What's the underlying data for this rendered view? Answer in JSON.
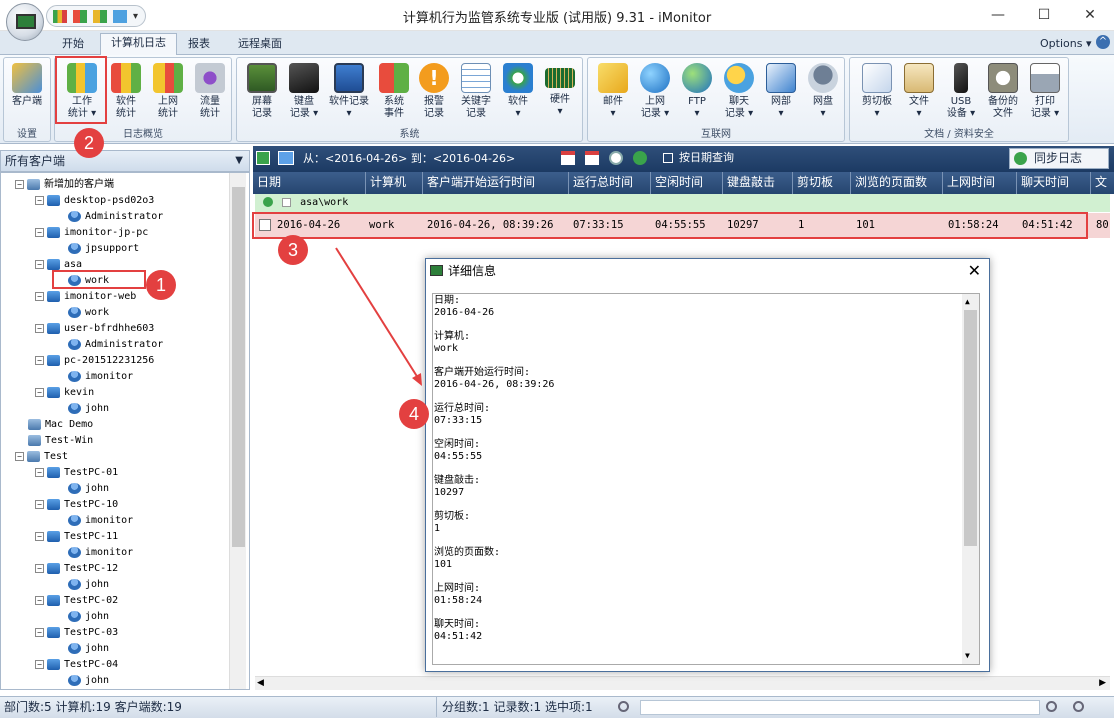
{
  "window": {
    "title": "计算机行为监管系统专业版 (试用版) 9.31 - iMonitor",
    "minimize": "—",
    "maximize": "☐",
    "close": "✕"
  },
  "ribbon": {
    "tabs": [
      "开始",
      "计算机日志",
      "报表",
      "远程桌面"
    ],
    "options": "Options ▾",
    "groups": [
      {
        "label": "设置",
        "buttons": [
          "客户端"
        ]
      },
      {
        "label": "日志概览",
        "buttons": [
          "工作\n统计 ▾",
          "软件\n统计",
          "上网\n统计",
          "流量\n统计"
        ]
      },
      {
        "label": "系统",
        "buttons": [
          "屏幕\n记录",
          "键盘\n记录 ▾",
          "软件记录\n▾",
          "系统\n事件",
          "报警\n记录",
          "关键字\n记录",
          "软件\n▾",
          "硬件\n▾"
        ]
      },
      {
        "label": "互联网",
        "buttons": [
          "邮件\n▾",
          "上网\n记录 ▾",
          "FTP\n▾",
          "聊天\n记录 ▾",
          "网部\n▾",
          "网盘\n▾"
        ]
      },
      {
        "label": "文档 / 资料安全",
        "buttons": [
          "剪切板\n▾",
          "文件\n▾",
          "USB\n设备 ▾",
          "备份的\n文件",
          "打印\n记录 ▾"
        ]
      }
    ]
  },
  "left_panel": {
    "header": "所有客户端",
    "tree": [
      {
        "label": "新增加的客户端",
        "level": 0,
        "icon": "group-icon",
        "expander": "−"
      },
      {
        "label": "desktop-psd02o3",
        "level": 1,
        "icon": "computer-icon",
        "expander": "−"
      },
      {
        "label": "Administrator",
        "level": 2,
        "icon": "user-icon",
        "expander": ""
      },
      {
        "label": "imonitor-jp-pc",
        "level": 1,
        "icon": "computer-icon",
        "expander": "−"
      },
      {
        "label": "jpsupport",
        "level": 2,
        "icon": "user-icon",
        "expander": ""
      },
      {
        "label": "asa",
        "level": 1,
        "icon": "computer-icon",
        "expander": "−"
      },
      {
        "label": "work",
        "level": 2,
        "icon": "user-icon",
        "expander": ""
      },
      {
        "label": "imonitor-web",
        "level": 1,
        "icon": "computer-icon",
        "expander": "−"
      },
      {
        "label": "work",
        "level": 2,
        "icon": "user-icon",
        "expander": ""
      },
      {
        "label": "user-bfrdhhe603",
        "level": 1,
        "icon": "computer-icon",
        "expander": "−"
      },
      {
        "label": "Administrator",
        "level": 2,
        "icon": "user-icon",
        "expander": ""
      },
      {
        "label": "pc-201512231256",
        "level": 1,
        "icon": "computer-icon",
        "expander": "−"
      },
      {
        "label": "imonitor",
        "level": 2,
        "icon": "user-icon",
        "expander": ""
      },
      {
        "label": "kevin",
        "level": 1,
        "icon": "computer-icon",
        "expander": "−"
      },
      {
        "label": "john",
        "level": 2,
        "icon": "user-icon",
        "expander": ""
      },
      {
        "label": "Mac Demo",
        "level": 0,
        "icon": "group-icon",
        "expander": ""
      },
      {
        "label": "Test-Win",
        "level": 0,
        "icon": "group-icon",
        "expander": ""
      },
      {
        "label": "Test",
        "level": 0,
        "icon": "group-icon",
        "expander": "−"
      },
      {
        "label": "TestPC-01",
        "level": 1,
        "icon": "computer-icon",
        "expander": "−"
      },
      {
        "label": "john",
        "level": 2,
        "icon": "user-icon",
        "expander": ""
      },
      {
        "label": "TestPC-10",
        "level": 1,
        "icon": "computer-icon",
        "expander": "−"
      },
      {
        "label": "imonitor",
        "level": 2,
        "icon": "user-icon",
        "expander": ""
      },
      {
        "label": "TestPC-11",
        "level": 1,
        "icon": "computer-icon",
        "expander": "−"
      },
      {
        "label": "imonitor",
        "level": 2,
        "icon": "user-icon",
        "expander": ""
      },
      {
        "label": "TestPC-12",
        "level": 1,
        "icon": "computer-icon",
        "expander": "−"
      },
      {
        "label": "john",
        "level": 2,
        "icon": "user-icon",
        "expander": ""
      },
      {
        "label": "TestPC-02",
        "level": 1,
        "icon": "computer-icon",
        "expander": "−"
      },
      {
        "label": "john",
        "level": 2,
        "icon": "user-icon",
        "expander": ""
      },
      {
        "label": "TestPC-03",
        "level": 1,
        "icon": "computer-icon",
        "expander": "−"
      },
      {
        "label": "john",
        "level": 2,
        "icon": "user-icon",
        "expander": ""
      },
      {
        "label": "TestPC-04",
        "level": 1,
        "icon": "computer-icon",
        "expander": "−"
      },
      {
        "label": "john",
        "level": 2,
        "icon": "user-icon",
        "expander": ""
      }
    ]
  },
  "toolbar": {
    "date_range": "从：<2016-04-26> 到：<2016-04-26>",
    "by_date": "按日期查询",
    "sync": "同步日志"
  },
  "grid": {
    "columns": [
      "日期",
      "计算机",
      "客户端开始运行时间",
      "运行总时间",
      "空闲时间",
      "键盘敲击",
      "剪切板",
      "浏览的页面数",
      "上网时间",
      "聊天时间",
      "文"
    ],
    "group": "asa\\work",
    "row": [
      "2016-04-26",
      "work",
      "2016-04-26, 08:39:26",
      "07:33:15",
      "04:55:55",
      "10297",
      "1",
      "101",
      "01:58:24",
      "04:51:42",
      "80"
    ]
  },
  "dialog": {
    "title": "详细信息",
    "fields": [
      {
        "label": "日期:",
        "value": "2016-04-26"
      },
      {
        "label": "计算机:",
        "value": "work"
      },
      {
        "label": "客户端开始运行时间:",
        "value": "2016-04-26, 08:39:26"
      },
      {
        "label": "运行总时间:",
        "value": "07:33:15"
      },
      {
        "label": "空闲时间:",
        "value": "04:55:55"
      },
      {
        "label": "键盘敲击:",
        "value": "10297"
      },
      {
        "label": "剪切板:",
        "value": "1"
      },
      {
        "label": "浏览的页面数:",
        "value": "101"
      },
      {
        "label": "上网时间:",
        "value": "01:58:24"
      },
      {
        "label": "聊天时间:",
        "value": "04:51:42"
      }
    ]
  },
  "status": {
    "left": "部门数:5 计算机:19 客户端数:19",
    "right": "分组数:1 记录数:1 选中项:1"
  },
  "annotations": [
    "1",
    "2",
    "3",
    "4"
  ],
  "colors": {
    "accent_red": "#e34040",
    "selected_row": "#f5d5d5",
    "group_row": "#d1f0d1",
    "header_navy": "#25456f"
  }
}
